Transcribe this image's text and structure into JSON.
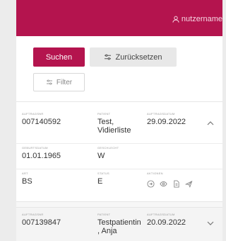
{
  "header": {
    "username": "nutzername"
  },
  "toolbar": {
    "search_label": "Suchen",
    "reset_label": "Zurücksetzen",
    "filter_label": "Filter"
  },
  "results": [
    {
      "auftragsnr_label": "AUFTRAGSNR",
      "auftragsnr": "007140592",
      "patient_label": "PATIENT",
      "patient": "Test, Vidierliste",
      "datum_label": "AUFTRAGSDATUM",
      "datum": "29.09.2022",
      "geburtsdatum_label": "GEBURTSDATUM",
      "geburtsdatum": "01.01.1965",
      "geschlecht_label": "GESCHLECHT",
      "geschlecht": "W",
      "art_label": "ART",
      "art": "BS",
      "status_label": "STATUS",
      "status": "E",
      "aktionen_label": "AKTIONEN",
      "expanded": true
    },
    {
      "auftragsnr_label": "AUFTRAGSNR",
      "auftragsnr": "007139847",
      "patient_label": "PATIENT",
      "patient": "Testpatientin , Anja",
      "datum_label": "AUFTRAGSDATUM",
      "datum": "20.09.2022",
      "expanded": false
    }
  ],
  "icons": {
    "user": "user-icon",
    "reset": "sliders-icon",
    "filter": "sliders-icon",
    "collapse": "chevron-up-icon",
    "expand": "chevron-down-icon",
    "actions": [
      "circle-arrow-icon",
      "eye-icon",
      "document-icon",
      "send-icon"
    ]
  },
  "colors": {
    "brand": "#b4144e",
    "background": "#ececec"
  }
}
